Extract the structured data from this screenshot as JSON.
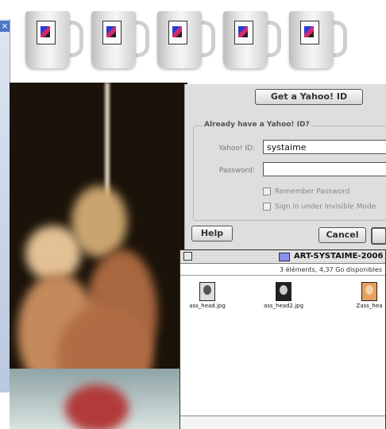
{
  "mugs": [
    "mug-1",
    "mug-2",
    "mug-3",
    "mug-4",
    "mug-5"
  ],
  "left_strip": {
    "close_glyph": "×"
  },
  "yahoo_dialog": {
    "get_id_button": "Get a Yahoo! ID",
    "group_title": "Already have a Yahoo! ID?",
    "yahoo_id_label": "Yahoo! ID:",
    "yahoo_id_value": "systaime",
    "password_label": "Password:",
    "password_value": "",
    "remember_password": "Remember Password",
    "invisible_mode": "Sign in under Invisible Mode",
    "help_button": "Help",
    "cancel_button": "Cancel"
  },
  "finder": {
    "title": "ART-SYSTAIME-2006",
    "info": "3 éléments, 4,37 Go disponibles",
    "files": [
      {
        "name": "ass_head.jpg"
      },
      {
        "name": "ass_head2.jpg"
      },
      {
        "name": "Zass_hea"
      }
    ]
  },
  "colors": {
    "dialog_bg": "#dedede",
    "folder_icon": "#8b8ff0",
    "left_strip_accent": "#4c77c8"
  }
}
